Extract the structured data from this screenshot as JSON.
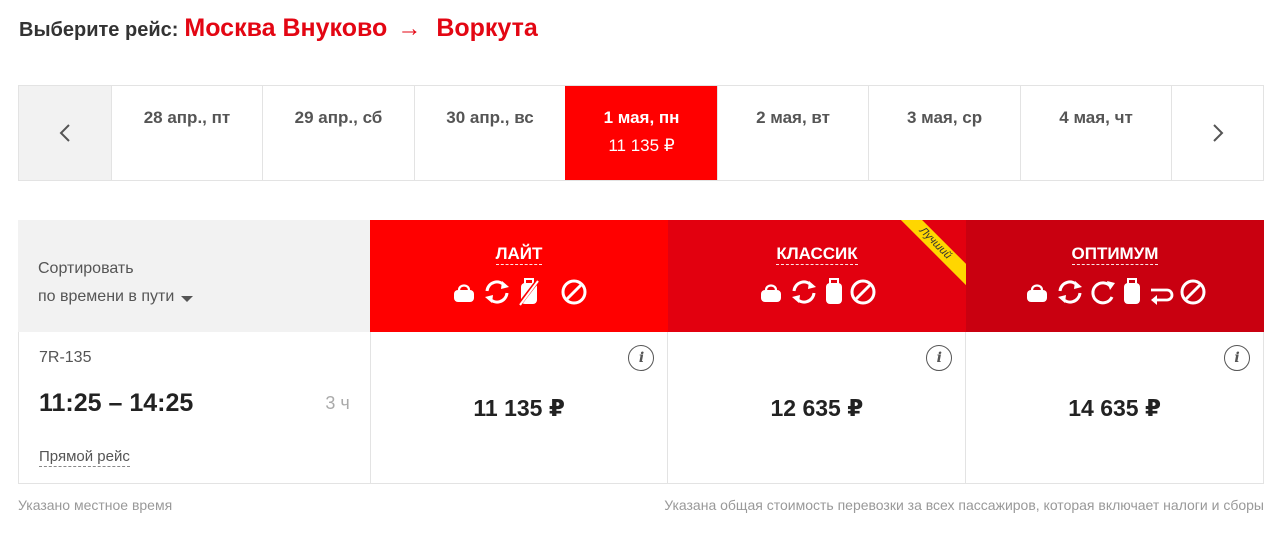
{
  "header": {
    "label": "Выберите рейс:",
    "origin": "Москва Внуково",
    "arrow": "→",
    "destination": "Воркута"
  },
  "dates": [
    {
      "date": "28 апр., пт",
      "price": "",
      "active": false
    },
    {
      "date": "29 апр., сб",
      "price": "",
      "active": false
    },
    {
      "date": "30 апр., вс",
      "price": "",
      "active": false
    },
    {
      "date": "1 мая, пн",
      "price": "11 135 ₽",
      "active": true
    },
    {
      "date": "2 мая, вт",
      "price": "",
      "active": false
    },
    {
      "date": "3 мая, ср",
      "price": "",
      "active": false
    },
    {
      "date": "4 мая, чт",
      "price": "",
      "active": false
    }
  ],
  "sort": {
    "title": "Сортировать",
    "by": "по времени в пути"
  },
  "tariffs": [
    {
      "name": "ЛАЙТ",
      "icons": [
        "bag-icon",
        "exchange-icon",
        "no-baggage-icon",
        "no-refund-icon"
      ]
    },
    {
      "name": "КЛАССИК",
      "badge": "Лучший",
      "icons": [
        "bag-icon",
        "exchange-icon",
        "baggage-icon",
        "no-refund-icon"
      ]
    },
    {
      "name": "ОПТИМУМ",
      "icons": [
        "bag-icon",
        "exchange-icon",
        "refresh-icon",
        "baggage-icon",
        "return-icon",
        "no-refund-icon"
      ]
    }
  ],
  "flight": {
    "number": "7R-135",
    "times": "11:25 – 14:25",
    "duration": "3 ч",
    "type": "Прямой рейс",
    "prices": [
      "11 135 ₽",
      "12 635 ₽",
      "14 635 ₽"
    ],
    "info_glyph": "i"
  },
  "footer": {
    "left": "Указано местное время",
    "right": "Указана общая стоимость перевозки за всех пассажиров, которая включает налоги и сборы"
  },
  "colors": {
    "accent": "#e30613",
    "lite": "#ff0000",
    "classic": "#e2000f",
    "optimum": "#c90010",
    "badge": "#ffd600"
  }
}
